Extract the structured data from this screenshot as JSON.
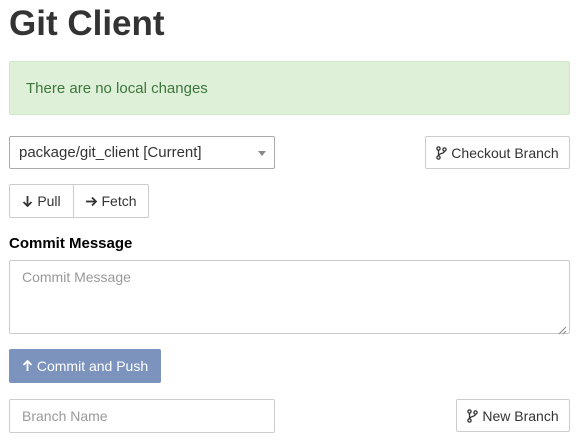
{
  "page": {
    "title": "Git Client"
  },
  "status": {
    "message": "There are no local changes"
  },
  "branch_select": {
    "selected": "package/git_client [Current]"
  },
  "toolbar": {
    "checkout_label": "Checkout Branch",
    "pull_label": "Pull",
    "fetch_label": "Fetch"
  },
  "commit": {
    "label": "Commit Message",
    "placeholder": "Commit Message",
    "button_label": "Commit and Push"
  },
  "new_branch": {
    "placeholder": "Branch Name",
    "button_label": "New Branch"
  },
  "icons": {
    "checkout": "git-branch-icon",
    "pull": "arrow-down-icon",
    "fetch": "arrow-right-icon",
    "commit": "arrow-up-icon",
    "new_branch": "git-branch-icon"
  },
  "colors": {
    "alert_bg": "#dff0d8",
    "alert_text": "#3c763d",
    "primary_button": "#7b93bd"
  }
}
